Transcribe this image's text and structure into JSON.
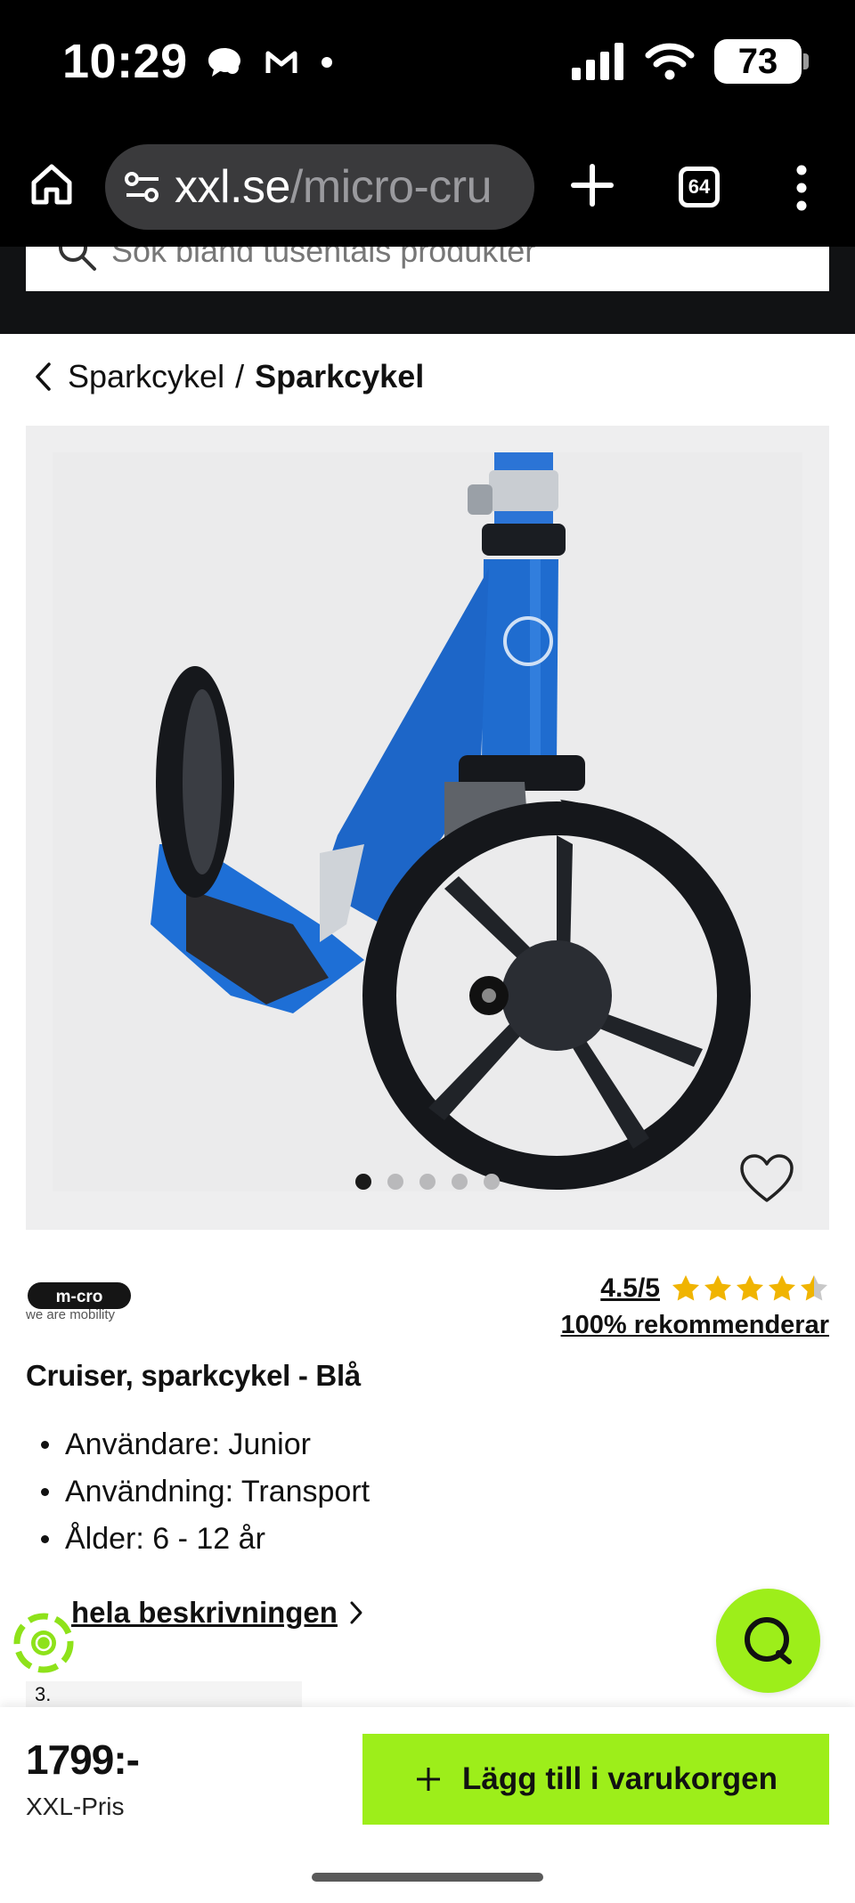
{
  "status_bar": {
    "time": "10:29",
    "battery": "73",
    "battery_level": 0.73,
    "icons": [
      "chat-bubble-icon",
      "mail-m-icon",
      "dot-icon",
      "signal-icon",
      "wifi-icon",
      "battery-icon"
    ]
  },
  "browser": {
    "url_domain": "xxl.se",
    "url_path": "/micro-cru",
    "tab_count": "64",
    "icons": [
      "home-icon",
      "site-settings-icon",
      "new-tab-plus-icon",
      "tabs-icon",
      "menu-dots-icon"
    ]
  },
  "search": {
    "placeholder": "Sök bland tusentals produkter"
  },
  "breadcrumb": {
    "parent": "Sparkcykel",
    "separator": "/",
    "current": "Sparkcykel"
  },
  "gallery": {
    "image_count": 5,
    "active_index": 0
  },
  "brand": {
    "logo_text": "m-cro",
    "tagline": "we are mobility"
  },
  "rating": {
    "score": "4.5/5",
    "stars": 4.5,
    "recommend": "100% rekommenderar"
  },
  "product": {
    "title": "Cruiser, sparkcykel - Blå",
    "bullets": [
      "Användare: Junior",
      "Användning: Transport",
      "Ålder: 6 - 12 år"
    ],
    "full_description_link": "hela beskrivningen"
  },
  "partial_card": {
    "label": "3."
  },
  "bottom_bar": {
    "price": "1799:-",
    "price_label": "XXL-Pris",
    "add_to_cart": "Lägg till i varukorgen"
  },
  "colors": {
    "accent_green": "#9dee1a",
    "scooter_blue": "#1e6fd6",
    "dark": "#000000"
  }
}
